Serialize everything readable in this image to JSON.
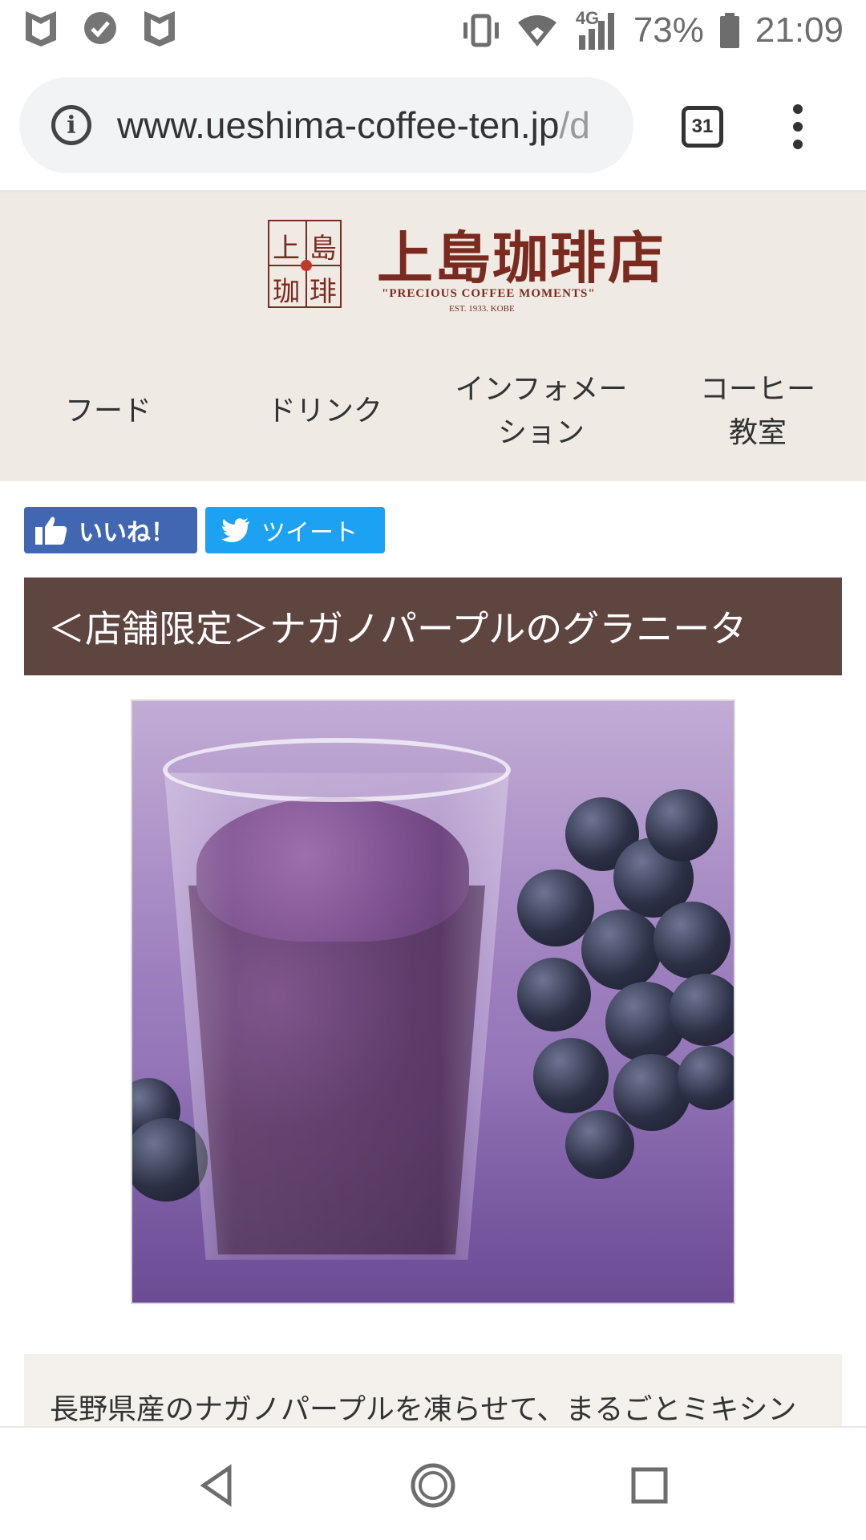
{
  "status_bar": {
    "network": "4G",
    "battery": "73%",
    "time": "21:09"
  },
  "browser": {
    "url_main": "www.ueshima-coffee-ten.jp",
    "url_faded": "/d",
    "tab_count": "31"
  },
  "site": {
    "logo": {
      "seal_chars": [
        "上",
        "島",
        "珈",
        "琲"
      ],
      "name": "上島珈琲店",
      "tagline": "\"PRECIOUS COFFEE MOMENTS\"",
      "est": "EST. 1933. KOBE"
    },
    "nav": [
      {
        "line1": "フード",
        "line2": ""
      },
      {
        "line1": "ドリンク",
        "line2": ""
      },
      {
        "line1": "インフォメー",
        "line2": "ション"
      },
      {
        "line1": "コーヒー",
        "line2": "教室"
      }
    ]
  },
  "social": {
    "like_label": "いいね！",
    "tweet_label": "ツイート"
  },
  "article": {
    "title": "＜店舗限定＞ナガノパープルのグラニータ",
    "description": "長野県産のナガノパープルを凍らせて、まるごとミキシン"
  },
  "colors": {
    "header_bg": "#efeae3",
    "brand_red": "#7a2a1e",
    "title_bar_bg": "#5e4540",
    "facebook_blue": "#4267b2",
    "twitter_blue": "#1da1f2"
  }
}
